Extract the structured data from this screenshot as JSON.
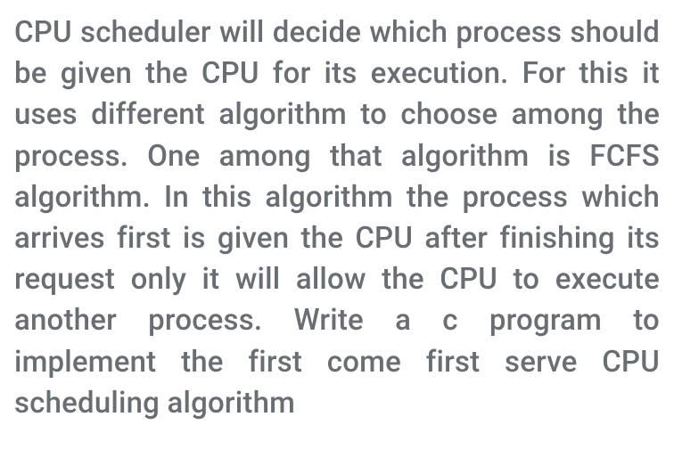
{
  "paragraph": {
    "text": "CPU scheduler will decide which process should be given the CPU for its execution. For this it uses different algorithm to choose among the process. One among that algorithm is FCFS algorithm. In this algorithm the process which arrives first is given the CPU after finishing its request only it will allow the CPU to execute another process. Write a c program to implement the first come first serve CPU scheduling algorithm"
  }
}
